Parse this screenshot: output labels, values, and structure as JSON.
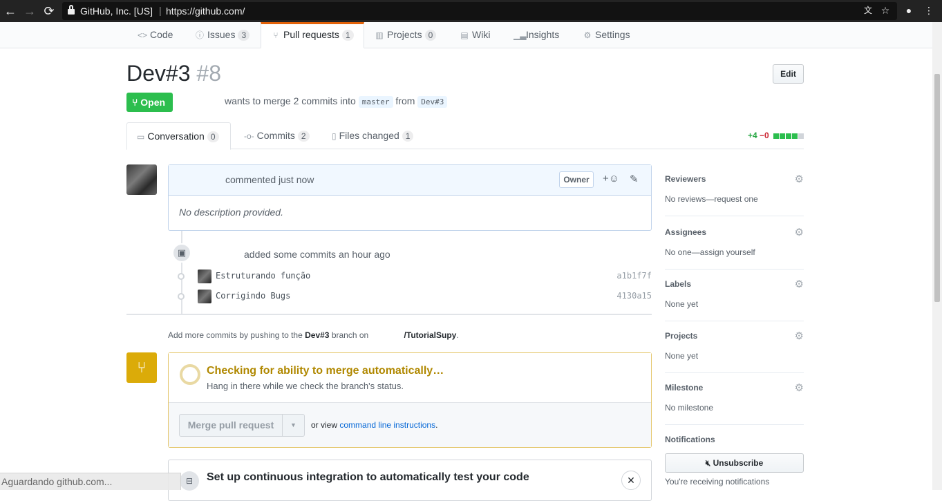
{
  "browser": {
    "org": "GitHub, Inc. [US]",
    "url": "https://github.com/",
    "icons": [
      "back-icon",
      "forward-icon",
      "reload-icon",
      "translate-icon",
      "star-icon",
      "extension-icon",
      "menu-icon"
    ]
  },
  "repo_tabs": [
    {
      "label": "Code",
      "icon": "code-icon"
    },
    {
      "label": "Issues",
      "count": "3",
      "icon": "issue-icon"
    },
    {
      "label": "Pull requests",
      "count": "1",
      "icon": "pr-icon"
    },
    {
      "label": "Projects",
      "count": "0",
      "icon": "project-icon"
    },
    {
      "label": "Wiki",
      "icon": "book-icon"
    },
    {
      "label": "Insights",
      "icon": "graph-icon"
    },
    {
      "label": "Settings",
      "icon": "gear-icon"
    }
  ],
  "pr": {
    "title": "Dev#3",
    "number": "#8",
    "edit_label": "Edit",
    "state": "Open",
    "merge_text_1": "wants to merge 2 commits into",
    "base_branch": "master",
    "merge_text_2": "from",
    "head_branch": "Dev#3"
  },
  "pr_tabs": [
    {
      "label": "Conversation",
      "count": "0"
    },
    {
      "label": "Commits",
      "count": "2"
    },
    {
      "label": "Files changed",
      "count": "1"
    }
  ],
  "diffstat": {
    "additions": "+4",
    "deletions": "−0",
    "blocks": [
      "#2cbe4e",
      "#2cbe4e",
      "#2cbe4e",
      "#2cbe4e",
      "#d1d5da"
    ]
  },
  "comment": {
    "meta": "commented just now",
    "badge": "Owner",
    "body": "No description provided.",
    "react_icon": "+☺"
  },
  "timeline": {
    "added_text": "added some commits an hour ago",
    "commits": [
      {
        "message": "Estruturando função",
        "sha": "a1b1f7f"
      },
      {
        "message": "Corrigindo Bugs",
        "sha": "4130a15"
      }
    ]
  },
  "push_hint": {
    "prefix": "Add more commits by pushing to the",
    "branch": "Dev#3",
    "middle": "branch on",
    "repo": "/TutorialSupy",
    "suffix": "."
  },
  "merge": {
    "title": "Checking for ability to merge automatically…",
    "subtitle": "Hang in there while we check the branch's status.",
    "button": "Merge pull request",
    "alt_prefix": "or view",
    "alt_link": "command line instructions",
    "alt_suffix": "."
  },
  "ci": {
    "title": "Set up continuous integration to automatically test your code",
    "close": "✕"
  },
  "sidebar": {
    "sections": [
      {
        "heading": "Reviewers",
        "value": "No reviews—request one"
      },
      {
        "heading": "Assignees",
        "value": "No one—assign yourself"
      },
      {
        "heading": "Labels",
        "value": "None yet"
      },
      {
        "heading": "Projects",
        "value": "None yet"
      },
      {
        "heading": "Milestone",
        "value": "No milestone"
      }
    ],
    "notifications_heading": "Notifications",
    "unsubscribe": "Unsubscribe",
    "notifications_note": "You're receiving notifications"
  },
  "status_bar": "Aguardando github.com..."
}
